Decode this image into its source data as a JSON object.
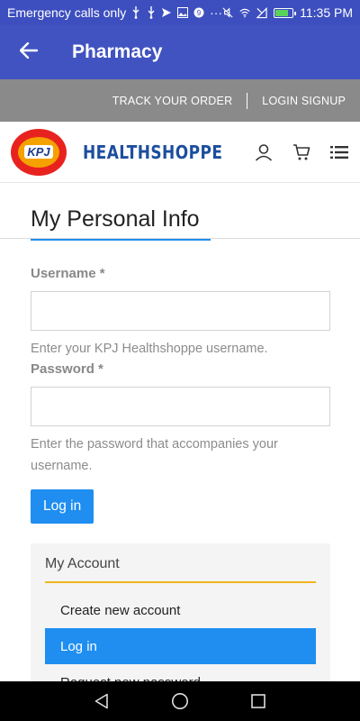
{
  "status_bar": {
    "left_text": "Emergency calls only",
    "time": "11:35 PM",
    "more": "···",
    "battery_color": "#5bd35b"
  },
  "app_bar": {
    "title": "Pharmacy",
    "back_icon": "arrow-left-icon",
    "color": "#4153c0"
  },
  "links_bar": {
    "track_order": "TRACK YOUR ORDER",
    "login_signup": "LOGIN SIGNUP"
  },
  "header": {
    "logo_text": "KPJ",
    "brand_name": "HEALTHSHOPPE",
    "icons": [
      "user-icon",
      "cart-icon",
      "menu-list-icon"
    ]
  },
  "page": {
    "title": "My Personal Info",
    "accent": "#1f8ef0"
  },
  "form": {
    "username_label": "Username *",
    "username_value": "",
    "username_help": "Enter your KPJ Healthshoppe username.",
    "password_label": "Password *",
    "password_value": "",
    "password_help": "Enter the password that accompanies your username.",
    "login_button": "Log in"
  },
  "account": {
    "title": "My Account",
    "items": [
      {
        "label": "Create new account",
        "active": false
      },
      {
        "label": "Log in",
        "active": true
      },
      {
        "label": "Request new password",
        "active": false
      }
    ]
  },
  "nav_bar": {
    "icons": [
      "back-triangle-icon",
      "home-circle-icon",
      "recents-square-icon"
    ]
  }
}
